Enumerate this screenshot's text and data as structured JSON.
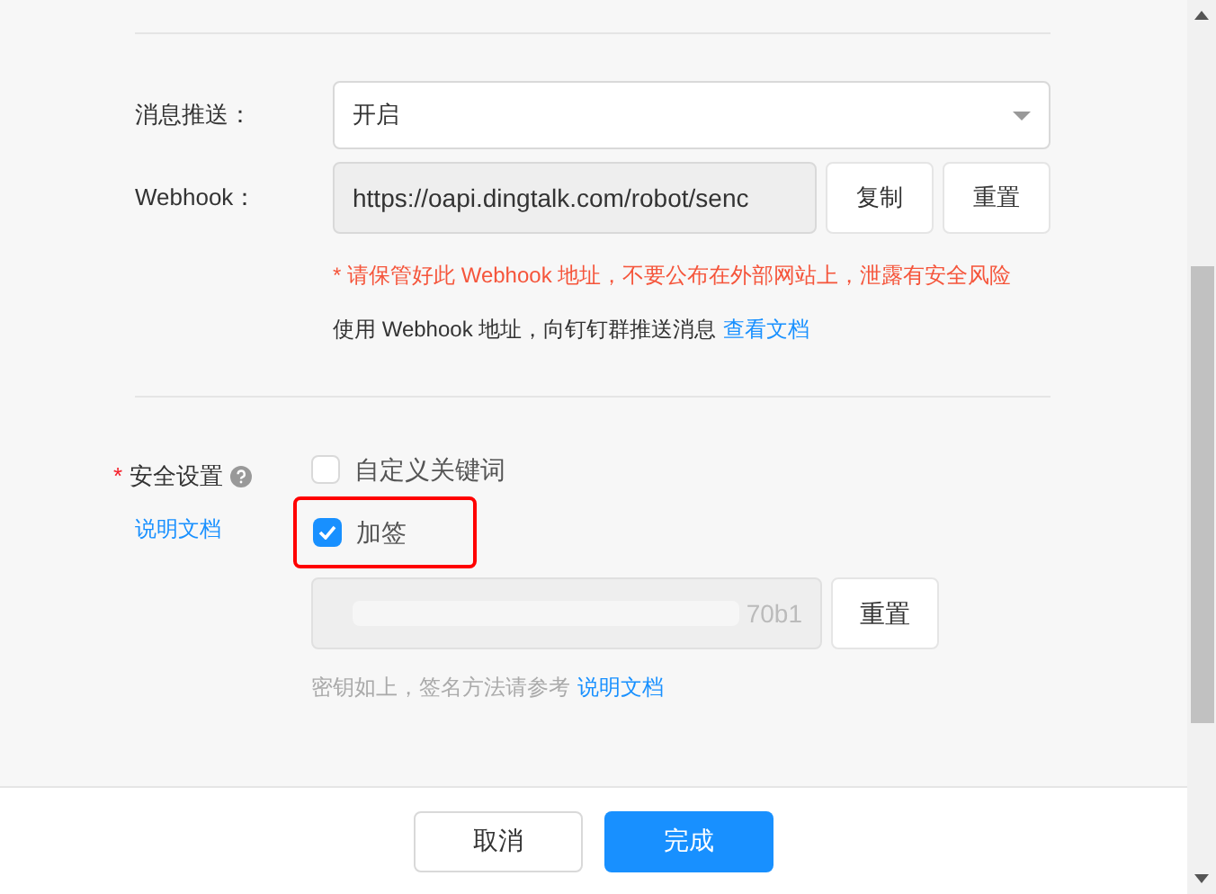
{
  "push": {
    "label": "消息推送：",
    "value": "开启"
  },
  "webhook": {
    "label": "Webhook：",
    "value": "https://oapi.dingtalk.com/robot/senc",
    "buttons": [
      "复制",
      "重置"
    ],
    "warning": "* 请保管好此 Webhook 地址，不要公布在外部网站上，泄露有安全风险",
    "hint": "使用 Webhook 地址，向钉钉群推送消息",
    "link": "查看文档"
  },
  "security": {
    "required_mark": "*",
    "label": "安全设置",
    "doc_link": "说明文档",
    "options": [
      {
        "label": "自定义关键词",
        "checked": false,
        "highlighted": false
      },
      {
        "label": "加签",
        "checked": true,
        "highlighted": true
      }
    ],
    "secret": {
      "value": "70b1",
      "reset": "重置",
      "hint": "密钥如上，签名方法请参考",
      "link": "说明文档"
    }
  },
  "footer": {
    "buttons": [
      {
        "label": "取消",
        "kind": "default"
      },
      {
        "label": "完成",
        "kind": "primary"
      }
    ]
  }
}
